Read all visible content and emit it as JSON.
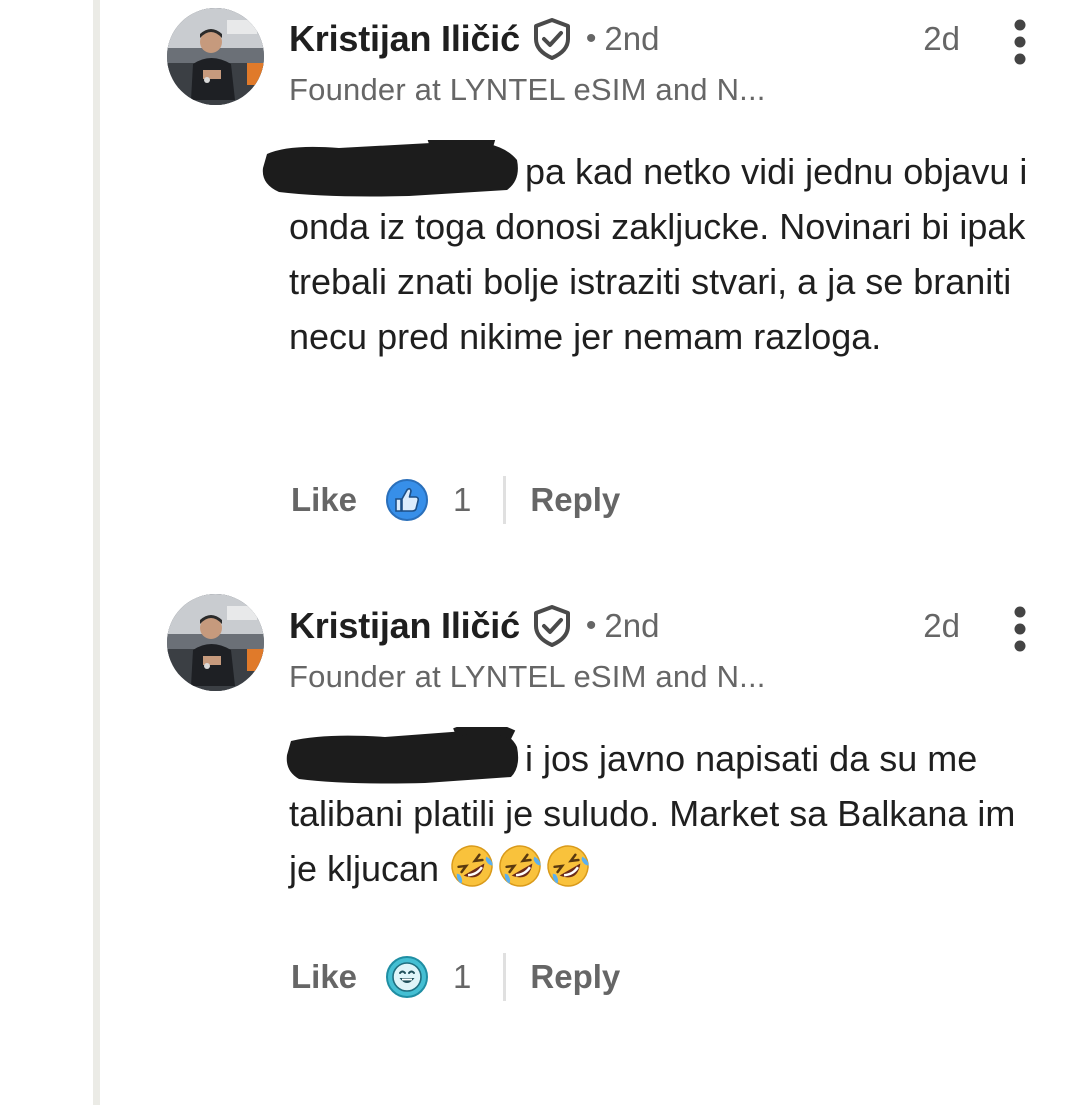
{
  "comments": [
    {
      "author": "Kristijan Iličić",
      "separator": "•",
      "degree": "2nd",
      "time": "2d",
      "headline": "Founder at LYNTEL eSIM and N...",
      "text_line1": "pa kad netko vidi jednu",
      "text_rest": "objavu i onda iz toga donosi zakljucke. Novinari bi ipak trebali znati bolje istraziti stvari, a ja se braniti necu pred nikime jer nemam razloga.",
      "like_label": "Like",
      "reaction": "like-icon",
      "reaction_count": "1",
      "reply_label": "Reply"
    },
    {
      "author": "Kristijan Iličić",
      "separator": "•",
      "degree": "2nd",
      "time": "2d",
      "headline": "Founder at LYNTEL eSIM and N...",
      "text_line1": "i jos javno napisati da su",
      "text_rest": "me talibani platili je suludo. Market sa Balkana im je kljucan",
      "emojis": [
        "rolling-on-floor-laughing-emoji",
        "rolling-on-floor-laughing-emoji",
        "rolling-on-floor-laughing-emoji"
      ],
      "like_label": "Like",
      "reaction": "funny-icon",
      "reaction_count": "1",
      "reply_label": "Reply"
    }
  ],
  "colors": {
    "text_primary": "#1f1f1f",
    "text_secondary": "#666666",
    "like_blue": "#378fe9",
    "funny_teal": "#44bfd3",
    "thread_line": "#ebebe6"
  }
}
